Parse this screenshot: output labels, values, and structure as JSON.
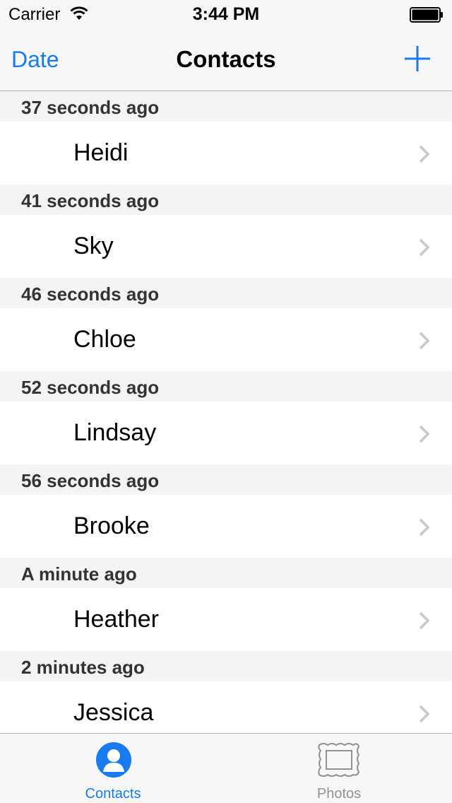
{
  "status_bar": {
    "carrier": "Carrier",
    "time": "3:44 PM",
    "wifi_icon": "wifi-icon",
    "battery_icon": "battery-icon"
  },
  "nav": {
    "left_label": "Date",
    "title": "Contacts",
    "add_icon": "plus-icon"
  },
  "colors": {
    "accent": "#1a7bf0",
    "section_bg": "#f4f4f4",
    "inactive_tab": "#929292"
  },
  "sections": [
    {
      "header": "37 seconds ago",
      "name": "Heidi"
    },
    {
      "header": "41 seconds ago",
      "name": "Sky"
    },
    {
      "header": "46 seconds ago",
      "name": "Chloe"
    },
    {
      "header": "52 seconds ago",
      "name": "Lindsay"
    },
    {
      "header": "56 seconds ago",
      "name": "Brooke"
    },
    {
      "header": "A minute ago",
      "name": "Heather"
    },
    {
      "header": "2 minutes ago",
      "name": "Jessica"
    }
  ],
  "tabs": [
    {
      "label": "Contacts",
      "icon": "person-icon",
      "selected": true
    },
    {
      "label": "Photos",
      "icon": "picture-frame-icon",
      "selected": false
    }
  ]
}
